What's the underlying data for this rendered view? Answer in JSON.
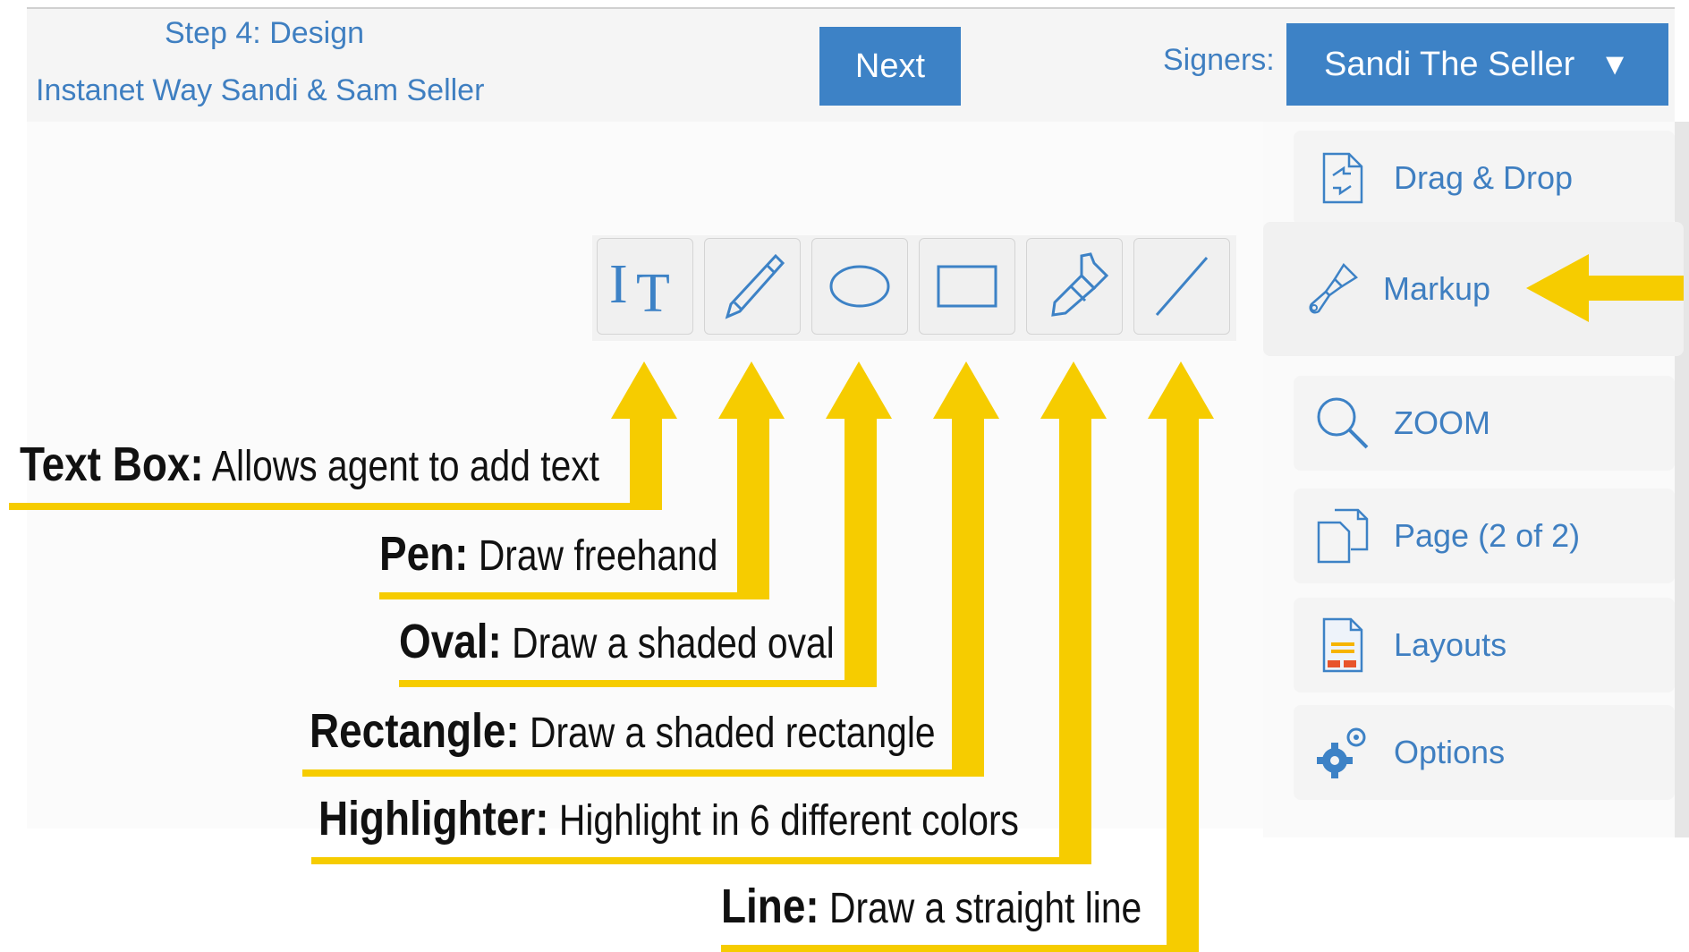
{
  "header": {
    "step_title": "Step 4: Design",
    "doc_title": "Instanet Way Sandi & Sam Seller",
    "next_label": "Next",
    "signers_label": "Signers:",
    "signers_value": "Sandi The Seller",
    "caret": "▼"
  },
  "tools": [
    {
      "name": "text-box",
      "icon": "text-tool-icon"
    },
    {
      "name": "pen",
      "icon": "pen-icon"
    },
    {
      "name": "oval",
      "icon": "oval-icon"
    },
    {
      "name": "rectangle",
      "icon": "rectangle-icon"
    },
    {
      "name": "highlighter",
      "icon": "highlighter-icon"
    },
    {
      "name": "line",
      "icon": "line-icon"
    }
  ],
  "panel": {
    "items": [
      {
        "label": "Drag & Drop",
        "icon": "drag-drop-icon"
      },
      {
        "label": "Markup",
        "icon": "paintbrush-icon"
      },
      {
        "label": "ZOOM",
        "icon": "magnifier-icon"
      },
      {
        "label": "Page (2 of 2)",
        "icon": "pages-icon"
      },
      {
        "label": "Layouts",
        "icon": "layouts-icon"
      },
      {
        "label": "Options",
        "icon": "gears-icon"
      }
    ]
  },
  "annotations": [
    {
      "term": "Text Box:",
      "desc": "Allows agent to add text"
    },
    {
      "term": "Pen:",
      "desc": "Draw freehand"
    },
    {
      "term": "Oval:",
      "desc": "Draw a shaded oval"
    },
    {
      "term": "Rectangle:",
      "desc": "Draw a shaded rectangle"
    },
    {
      "term": "Highlighter:",
      "desc": "Highlight in 6 different colors"
    },
    {
      "term": "Line:",
      "desc": "Draw a straight line"
    }
  ],
  "colors": {
    "accent": "#3d82c6",
    "link_text": "#3f7fc1",
    "annotation": "#f6cc00"
  }
}
